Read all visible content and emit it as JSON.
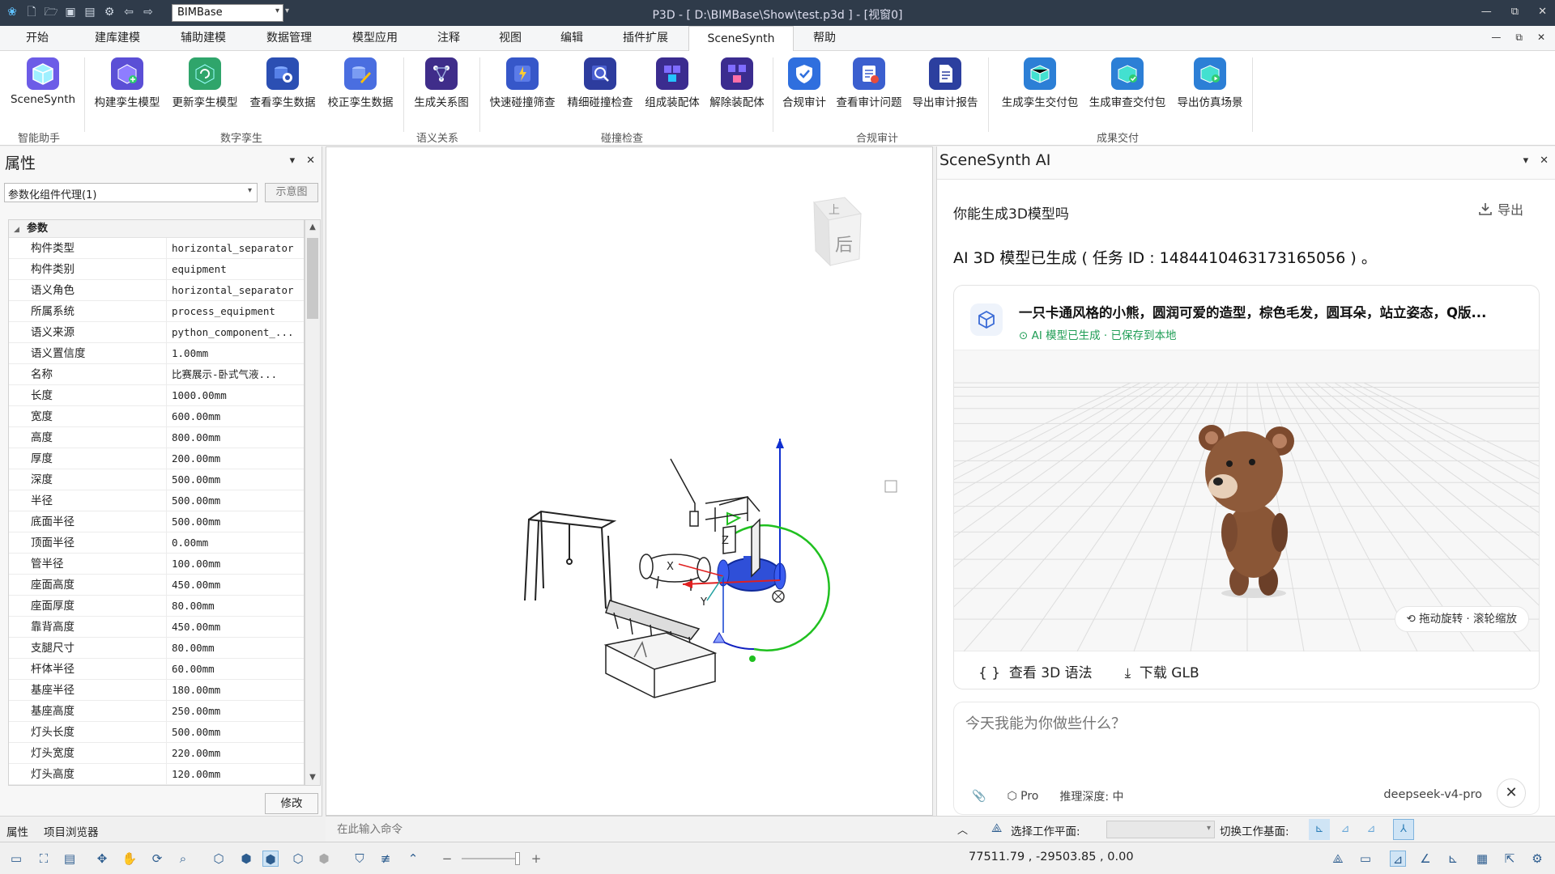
{
  "titlebar": {
    "workspace": "BIMBase",
    "title": "P3D - [ D:\\BIMBase\\Show\\test.p3d ] - [视窗0]",
    "min": "—",
    "restore": "⧉",
    "close": "✕"
  },
  "menu": {
    "tabs": [
      "开始",
      "建库建模",
      "辅助建模",
      "数据管理",
      "模型应用",
      "注释",
      "视图",
      "编辑",
      "插件扩展",
      "SceneSynth",
      "帮助"
    ],
    "active": "SceneSynth",
    "ctrl_min": "—",
    "ctrl_restore": "⧉",
    "ctrl_close": "✕"
  },
  "ribbon": {
    "buttons": [
      {
        "label": "SceneSynth",
        "color": "#6c5ce7"
      },
      {
        "label": "构建孪生模型",
        "color": "#5b4fd6"
      },
      {
        "label": "更新孪生模型",
        "color": "#2fa56b"
      },
      {
        "label": "查看孪生数据",
        "color": "#2b4fb3"
      },
      {
        "label": "校正孪生数据",
        "color": "#4a6ee0"
      },
      {
        "label": "生成关系图",
        "color": "#3f2d8a"
      },
      {
        "label": "快速碰撞筛查",
        "color": "#3657c9"
      },
      {
        "label": "精细碰撞检查",
        "color": "#2d3c9e"
      },
      {
        "label": "组成装配体",
        "color": "#3b2c8f"
      },
      {
        "label": "解除装配体",
        "color": "#3b2c8f"
      },
      {
        "label": "合规审计",
        "color": "#2f6fde"
      },
      {
        "label": "查看审计问题",
        "color": "#3b5fcf"
      },
      {
        "label": "导出审计报告",
        "color": "#2c3f9f"
      },
      {
        "label": "生成孪生交付包",
        "color": "#2c7fd6"
      },
      {
        "label": "生成审查交付包",
        "color": "#2c7fd6"
      },
      {
        "label": "导出仿真场景",
        "color": "#2c7fd6"
      }
    ],
    "groups": [
      "智能助手",
      "数字孪生",
      "语义关系",
      "碰撞检查",
      "合规审计",
      "成果交付"
    ]
  },
  "properties": {
    "title": "属性",
    "selector": "参数化组件代理(1)",
    "preview_button": "示意图",
    "section": "参数",
    "rows": [
      {
        "k": "构件类型",
        "v": "horizontal_separator"
      },
      {
        "k": "构件类别",
        "v": "equipment"
      },
      {
        "k": "语义角色",
        "v": "horizontal_separator"
      },
      {
        "k": "所属系统",
        "v": "process_equipment"
      },
      {
        "k": "语义来源",
        "v": "python_component_..."
      },
      {
        "k": "语义置信度",
        "v": "1.00mm"
      },
      {
        "k": "名称",
        "v": "比赛展示-卧式气液..."
      },
      {
        "k": "长度",
        "v": "1000.00mm"
      },
      {
        "k": "宽度",
        "v": "600.00mm"
      },
      {
        "k": "高度",
        "v": "800.00mm"
      },
      {
        "k": "厚度",
        "v": "200.00mm"
      },
      {
        "k": "深度",
        "v": "500.00mm"
      },
      {
        "k": "半径",
        "v": "500.00mm"
      },
      {
        "k": "底面半径",
        "v": "500.00mm"
      },
      {
        "k": "顶面半径",
        "v": "0.00mm"
      },
      {
        "k": "管半径",
        "v": "100.00mm"
      },
      {
        "k": "座面高度",
        "v": "450.00mm"
      },
      {
        "k": "座面厚度",
        "v": "80.00mm"
      },
      {
        "k": "靠背高度",
        "v": "450.00mm"
      },
      {
        "k": "支腿尺寸",
        "v": "80.00mm"
      },
      {
        "k": "杆体半径",
        "v": "60.00mm"
      },
      {
        "k": "基座半径",
        "v": "180.00mm"
      },
      {
        "k": "基座高度",
        "v": "250.00mm"
      },
      {
        "k": "灯头长度",
        "v": "500.00mm"
      },
      {
        "k": "灯头宽度",
        "v": "220.00mm"
      },
      {
        "k": "灯头高度",
        "v": "120.00mm"
      }
    ],
    "modify_button": "修改",
    "tabs": [
      "属性",
      "项目浏览器"
    ]
  },
  "viewport": {
    "cube_top": "上",
    "cube_front": "后",
    "axis_x": "X",
    "axis_y": "Y",
    "axis_z": "Z"
  },
  "command": {
    "placeholder": "在此输入命令",
    "workplane_label": "选择工作平面:",
    "switch_label": "切换工作基面:"
  },
  "ai": {
    "title": "SceneSynth AI",
    "user_message": "你能生成3D模型吗",
    "export_label": "导出",
    "reply": "AI 3D 模型已生成 ( 任务 ID : 1484410463173165056 ) 。",
    "card_title": "一只卡通风格的小熊，圆润可爱的造型，棕色毛发，圆耳朵，站立姿态，Q版...",
    "card_status": "AI 模型已生成 · 已保存到本地",
    "rotate_hint": "拖动旋转 · 滚轮缩放",
    "view_grammar": "查看 3D 语法",
    "download": "下载 GLB",
    "input_placeholder": "今天我能为你做些什么？",
    "mode": "Pro",
    "depth": "推理深度: 中",
    "model": "deepseek-v4-pro"
  },
  "status": {
    "coords": "77511.79 , -29503.85 , 0.00",
    "zoom_minus": "−",
    "zoom_plus": "+"
  }
}
